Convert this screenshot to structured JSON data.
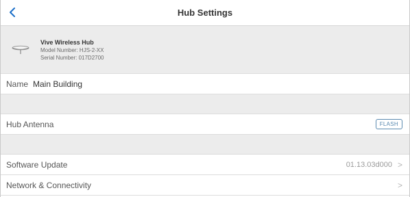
{
  "header": {
    "title": "Hub Settings",
    "back_icon": "back-chevron-icon"
  },
  "device": {
    "name": "Vive Wireless Hub",
    "model": "Model Number: HJS-2-XX",
    "serial": "Serial Number: 017D2700",
    "icon": "hub-device-icon"
  },
  "name_row": {
    "label": "Name",
    "value": "Main Building"
  },
  "antenna_row": {
    "label": "Hub Antenna",
    "button_label": "FLASH"
  },
  "software_row": {
    "label": "Software Update",
    "value": "01.13.03d000",
    "chevron": ">"
  },
  "network_row": {
    "label": "Network & Connectivity",
    "chevron": ">"
  },
  "colors": {
    "accent": "#1a6ec8",
    "background_gray": "#ececec",
    "button_border": "#5a8ab0"
  }
}
